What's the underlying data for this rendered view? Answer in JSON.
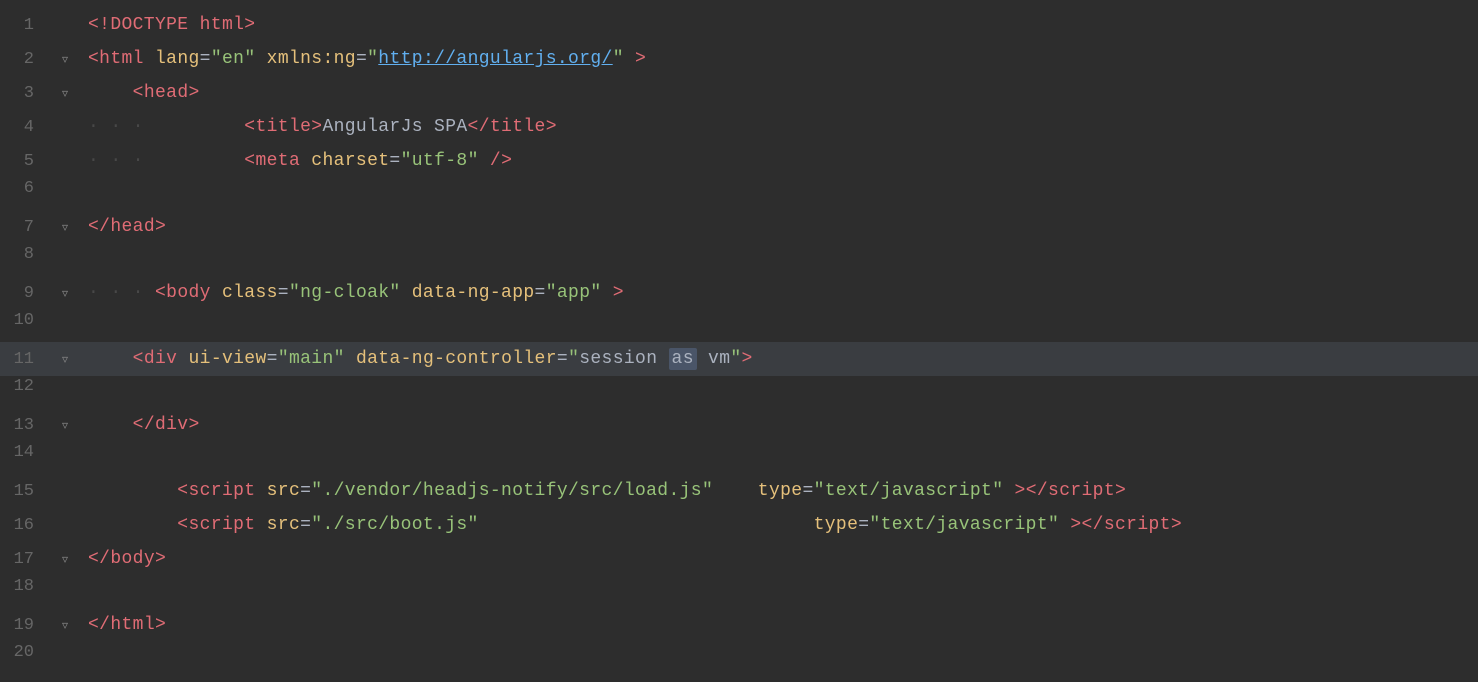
{
  "editor": {
    "background": "#2d2d2d",
    "lines": [
      {
        "number": 1,
        "hasFold": false,
        "indentLevel": 0,
        "tokens": [
          {
            "type": "tag-bracket",
            "text": "<!DOCTYPE html>"
          }
        ]
      },
      {
        "number": 2,
        "hasFold": true,
        "foldOpen": true,
        "indentLevel": 0,
        "tokens": [
          {
            "type": "tag-bracket",
            "text": "<"
          },
          {
            "type": "tag",
            "text": "html"
          },
          {
            "type": "plain",
            "text": " "
          },
          {
            "type": "attr-name",
            "text": "lang"
          },
          {
            "type": "plain",
            "text": "="
          },
          {
            "type": "attr-value",
            "text": "\"en\""
          },
          {
            "type": "plain",
            "text": " "
          },
          {
            "type": "attr-name",
            "text": "xmlns:ng"
          },
          {
            "type": "plain",
            "text": "="
          },
          {
            "type": "attr-value",
            "text": "\""
          },
          {
            "type": "attr-value-url",
            "text": "http://angularjs.org/"
          },
          {
            "type": "attr-value",
            "text": "\""
          },
          {
            "type": "plain",
            "text": " "
          },
          {
            "type": "tag-bracket",
            "text": ">"
          }
        ]
      },
      {
        "number": 3,
        "hasFold": true,
        "foldOpen": true,
        "indentLevel": 1,
        "tokens": [
          {
            "type": "tag-bracket",
            "text": "<"
          },
          {
            "type": "tag",
            "text": "head"
          },
          {
            "type": "tag-bracket",
            "text": ">"
          }
        ]
      },
      {
        "number": 4,
        "hasFold": false,
        "indentLevel": 2,
        "tokens": [
          {
            "type": "tag-bracket",
            "text": "<"
          },
          {
            "type": "tag",
            "text": "title"
          },
          {
            "type": "tag-bracket",
            "text": ">"
          },
          {
            "type": "text-content",
            "text": "AngularJs SPA"
          },
          {
            "type": "tag-bracket",
            "text": "</"
          },
          {
            "type": "tag",
            "text": "title"
          },
          {
            "type": "tag-bracket",
            "text": ">"
          }
        ]
      },
      {
        "number": 5,
        "hasFold": false,
        "indentLevel": 2,
        "tokens": [
          {
            "type": "tag-bracket",
            "text": "<"
          },
          {
            "type": "tag",
            "text": "meta"
          },
          {
            "type": "plain",
            "text": " "
          },
          {
            "type": "attr-name",
            "text": "charset"
          },
          {
            "type": "plain",
            "text": "="
          },
          {
            "type": "attr-value",
            "text": "\"utf-8\""
          },
          {
            "type": "plain",
            "text": " "
          },
          {
            "type": "tag-bracket",
            "text": "/>"
          }
        ]
      },
      {
        "number": 6,
        "hasFold": false,
        "indentLevel": 0,
        "tokens": []
      },
      {
        "number": 7,
        "hasFold": true,
        "foldOpen": false,
        "indentLevel": 0,
        "tokens": [
          {
            "type": "tag-bracket",
            "text": "</"
          },
          {
            "type": "tag",
            "text": "head"
          },
          {
            "type": "tag-bracket",
            "text": ">"
          }
        ]
      },
      {
        "number": 8,
        "hasFold": false,
        "indentLevel": 0,
        "tokens": []
      },
      {
        "number": 9,
        "hasFold": true,
        "foldOpen": true,
        "indentLevel": 0,
        "tokens": [
          {
            "type": "tag-bracket",
            "text": "<"
          },
          {
            "type": "tag",
            "text": "body"
          },
          {
            "type": "plain",
            "text": " "
          },
          {
            "type": "attr-name",
            "text": "class"
          },
          {
            "type": "plain",
            "text": "="
          },
          {
            "type": "attr-value",
            "text": "\"ng-cloak\""
          },
          {
            "type": "plain",
            "text": " "
          },
          {
            "type": "attr-name",
            "text": "data-ng-app"
          },
          {
            "type": "plain",
            "text": "="
          },
          {
            "type": "attr-value",
            "text": "\"app\""
          },
          {
            "type": "plain",
            "text": " "
          },
          {
            "type": "tag-bracket",
            "text": ">"
          }
        ]
      },
      {
        "number": 10,
        "hasFold": false,
        "indentLevel": 0,
        "tokens": []
      },
      {
        "number": 11,
        "hasFold": true,
        "foldOpen": true,
        "indentLevel": 1,
        "highlight": true,
        "tokens": [
          {
            "type": "tag-bracket",
            "text": "<"
          },
          {
            "type": "tag",
            "text": "div"
          },
          {
            "type": "plain",
            "text": " "
          },
          {
            "type": "attr-name",
            "text": "ui-view"
          },
          {
            "type": "plain",
            "text": "="
          },
          {
            "type": "attr-value",
            "text": "\"main\""
          },
          {
            "type": "plain",
            "text": " "
          },
          {
            "type": "attr-name",
            "text": "data-ng-controller"
          },
          {
            "type": "plain",
            "text": "="
          },
          {
            "type": "attr-value",
            "text": "\""
          },
          {
            "type": "highlight-word",
            "text": "session"
          },
          {
            "type": "plain",
            "text": " "
          },
          {
            "type": "keyword-as",
            "text": "as"
          },
          {
            "type": "plain",
            "text": " "
          },
          {
            "type": "highlight-word2",
            "text": "vm"
          },
          {
            "type": "attr-value",
            "text": "\""
          },
          {
            "type": "tag-bracket",
            "text": ">"
          }
        ]
      },
      {
        "number": 12,
        "hasFold": false,
        "indentLevel": 0,
        "tokens": []
      },
      {
        "number": 13,
        "hasFold": true,
        "foldOpen": false,
        "indentLevel": 1,
        "tokens": [
          {
            "type": "tag-bracket",
            "text": "</"
          },
          {
            "type": "tag",
            "text": "div"
          },
          {
            "type": "tag-bracket",
            "text": ">"
          }
        ]
      },
      {
        "number": 14,
        "hasFold": false,
        "indentLevel": 0,
        "tokens": []
      },
      {
        "number": 15,
        "hasFold": false,
        "indentLevel": 2,
        "tokens": [
          {
            "type": "tag-bracket",
            "text": "<"
          },
          {
            "type": "tag",
            "text": "script"
          },
          {
            "type": "plain",
            "text": " "
          },
          {
            "type": "attr-name",
            "text": "src"
          },
          {
            "type": "plain",
            "text": "="
          },
          {
            "type": "attr-value",
            "text": "\"./vendor/headjs-notify/src/load.js\""
          },
          {
            "type": "plain",
            "text": "    "
          },
          {
            "type": "attr-name",
            "text": "type"
          },
          {
            "type": "plain",
            "text": "="
          },
          {
            "type": "attr-value",
            "text": "\"text/javascript\""
          },
          {
            "type": "plain",
            "text": " "
          },
          {
            "type": "tag-bracket",
            "text": "></"
          },
          {
            "type": "tag",
            "text": "script"
          },
          {
            "type": "tag-bracket",
            "text": ">"
          }
        ]
      },
      {
        "number": 16,
        "hasFold": false,
        "indentLevel": 2,
        "tokens": [
          {
            "type": "tag-bracket",
            "text": "<"
          },
          {
            "type": "tag",
            "text": "script"
          },
          {
            "type": "plain",
            "text": " "
          },
          {
            "type": "attr-name",
            "text": "src"
          },
          {
            "type": "plain",
            "text": "="
          },
          {
            "type": "attr-value",
            "text": "\"./src/boot.js\""
          },
          {
            "type": "plain",
            "text": "                              "
          },
          {
            "type": "attr-name",
            "text": "type"
          },
          {
            "type": "plain",
            "text": "="
          },
          {
            "type": "attr-value",
            "text": "\"text/javascript\""
          },
          {
            "type": "plain",
            "text": " "
          },
          {
            "type": "tag-bracket",
            "text": "></"
          },
          {
            "type": "tag",
            "text": "script"
          },
          {
            "type": "tag-bracket",
            "text": ">"
          }
        ]
      },
      {
        "number": 17,
        "hasFold": true,
        "foldOpen": false,
        "indentLevel": 0,
        "tokens": [
          {
            "type": "tag-bracket",
            "text": "</"
          },
          {
            "type": "tag",
            "text": "body"
          },
          {
            "type": "tag-bracket",
            "text": ">"
          }
        ]
      },
      {
        "number": 18,
        "hasFold": false,
        "indentLevel": 0,
        "tokens": []
      },
      {
        "number": 19,
        "hasFold": true,
        "foldOpen": false,
        "indentLevel": 0,
        "tokens": [
          {
            "type": "tag-bracket",
            "text": "</"
          },
          {
            "type": "tag",
            "text": "html"
          },
          {
            "type": "tag-bracket",
            "text": ">"
          }
        ]
      },
      {
        "number": 20,
        "hasFold": false,
        "indentLevel": 0,
        "tokens": []
      }
    ]
  }
}
